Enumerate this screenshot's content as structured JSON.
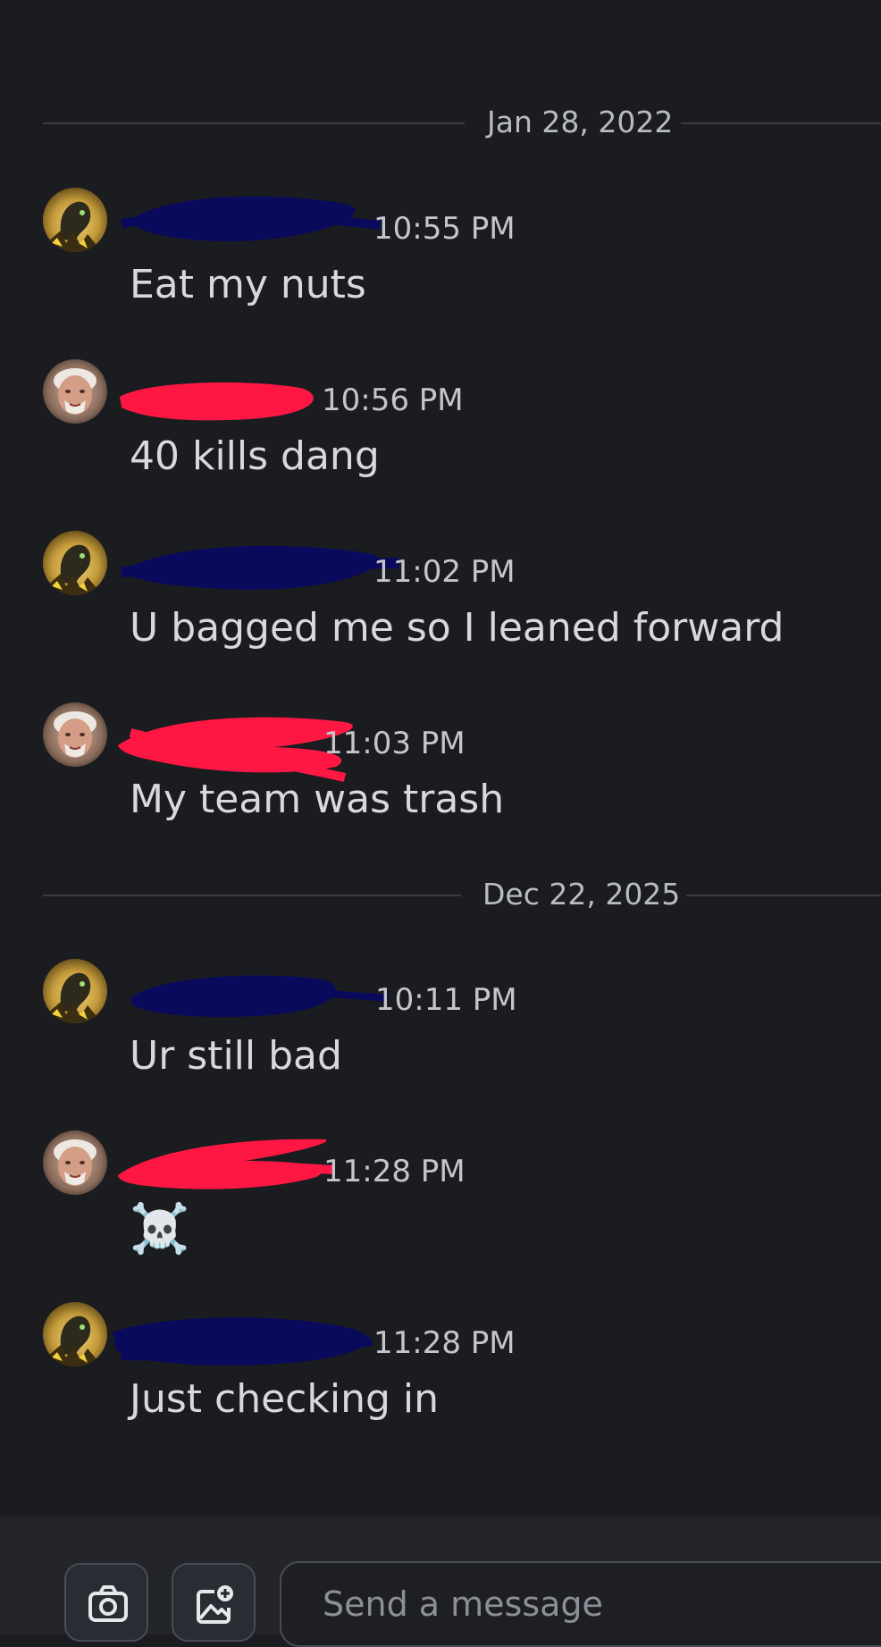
{
  "conversation": {
    "dividers": [
      {
        "date": "Jan 28, 2022"
      },
      {
        "date": "Dec 22, 2025"
      }
    ],
    "messages": [
      {
        "time": "10:55 PM",
        "text": "Eat my nuts",
        "avatar": "helmet-avatar-icon"
      },
      {
        "time": "10:56 PM",
        "text": "40 kills dang",
        "avatar": "old-man-avatar-icon"
      },
      {
        "time": "11:02 PM",
        "text": "U bagged me so I leaned forward",
        "avatar": "helmet-avatar-icon"
      },
      {
        "time": "11:03 PM",
        "text": "My team was trash",
        "avatar": "old-man-avatar-icon"
      },
      {
        "time": "10:11 PM",
        "text": "Ur still bad",
        "avatar": "helmet-avatar-icon"
      },
      {
        "time": "11:28 PM",
        "text": "☠️",
        "avatar": "old-man-avatar-icon"
      },
      {
        "time": "11:28 PM",
        "text": "Just checking in",
        "avatar": "helmet-avatar-icon"
      }
    ]
  },
  "composer": {
    "placeholder": "Send a message",
    "camera_icon": "camera-icon",
    "gallery_icon": "image-add-icon"
  },
  "colors": {
    "background": "#1b1c20",
    "composer_bg": "#24252b",
    "redact_blue": "#0a0a5c",
    "redact_red": "#ff1744"
  }
}
